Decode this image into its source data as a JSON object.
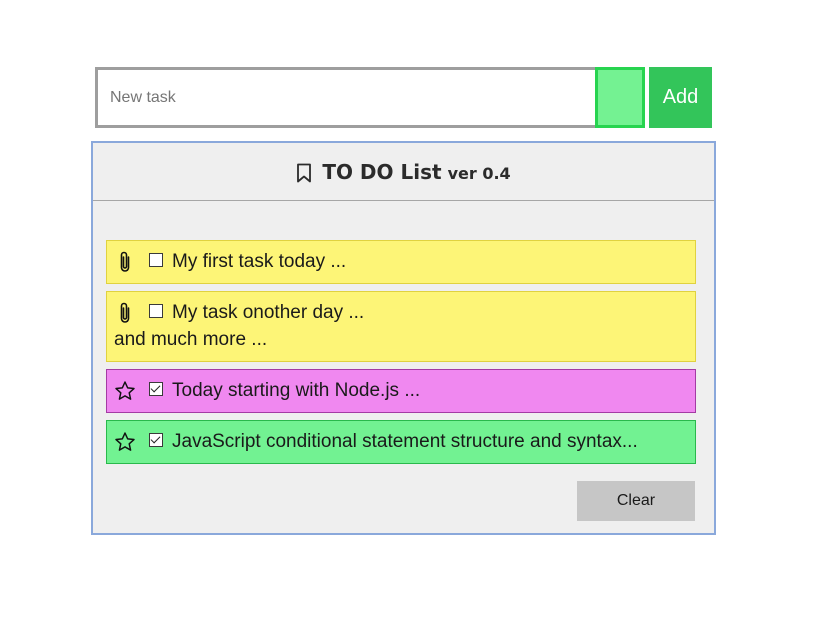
{
  "input": {
    "placeholder": "New task",
    "value": ""
  },
  "color_picker": {
    "color": "#74f292"
  },
  "add_button": {
    "label": "Add"
  },
  "header": {
    "title": "TO DO List",
    "version": "ver 0.4",
    "icon": "bookmark-icon"
  },
  "tasks": [
    {
      "line1": "My first task today ...",
      "line2": "",
      "checked": false,
      "icon": "paperclip-icon",
      "bg": "#fdf577",
      "border": "#e0d23f"
    },
    {
      "line1": "My task onother day ...",
      "line2": "and much more ...",
      "checked": false,
      "icon": "paperclip-icon",
      "bg": "#fdf577",
      "border": "#e0d23f"
    },
    {
      "line1": "Today starting with Node.js ...",
      "line2": "",
      "checked": true,
      "icon": "star-icon",
      "bg": "#f088f0",
      "border": "#a43ba4"
    },
    {
      "line1": "JavaScript conditional statement structure and syntax...",
      "line2": "",
      "checked": true,
      "icon": "star-icon",
      "bg": "#72f292",
      "border": "#29b94c"
    }
  ],
  "clear_button": {
    "label": "Clear"
  }
}
